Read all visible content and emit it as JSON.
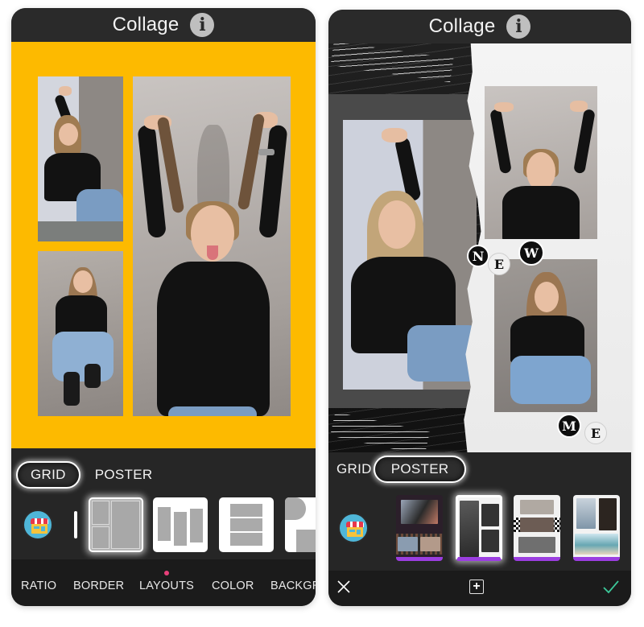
{
  "left_screen": {
    "header": {
      "title": "Collage",
      "info_icon": "info-icon"
    },
    "canvas": {
      "background_color": "#FDBA00",
      "layout": "grid-3-photos"
    },
    "mode_tabs": [
      {
        "label": "GRID",
        "active": true
      },
      {
        "label": "POSTER",
        "active": false
      }
    ],
    "store_icon": "store-icon",
    "layouts": [
      {
        "name": "two-left-one-right",
        "selected": true
      },
      {
        "name": "three-vertical-staggered",
        "selected": false
      },
      {
        "name": "three-horizontal-stacked",
        "selected": false
      },
      {
        "name": "shapes-circle-square",
        "selected": false
      }
    ],
    "bottom_nav": {
      "items": [
        "RATIO",
        "BORDER",
        "LAYOUTS",
        "COLOR",
        "BACKGR"
      ],
      "active": "LAYOUTS",
      "active_indicator_color": "#E8407A"
    }
  },
  "right_screen": {
    "header": {
      "title": "Collage",
      "info_icon": "info-icon"
    },
    "canvas": {
      "layout": "torn-paper-poster",
      "sticker_letters_top": [
        "N",
        "E",
        "W"
      ],
      "sticker_letters_bottom": [
        "M",
        "E"
      ]
    },
    "mode_tabs": [
      {
        "label": "GRID",
        "active": false
      },
      {
        "label": "POSTER",
        "active": true
      }
    ],
    "store_icon": "store-icon",
    "posters": [
      {
        "name": "film-strip-poster",
        "selected": false
      },
      {
        "name": "torn-paper-poster",
        "selected": true
      },
      {
        "name": "checkered-poster",
        "selected": false
      },
      {
        "name": "beach-poster",
        "selected": false
      }
    ],
    "poster_accent_color": "#9B3EE0",
    "action_bar": {
      "cancel_icon": "close-icon",
      "add_icon": "add-icon",
      "confirm_icon": "check-icon",
      "confirm_color": "#3CC99A"
    }
  }
}
